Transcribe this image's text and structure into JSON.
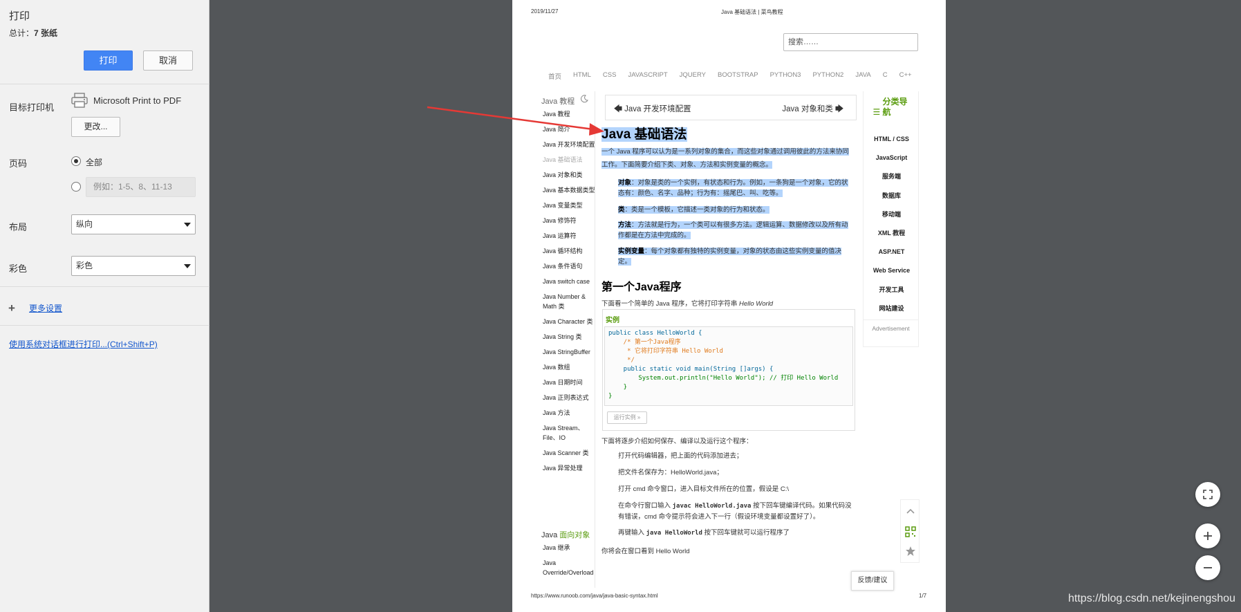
{
  "dialog": {
    "title": "打印",
    "total_label": "总计：",
    "total_value": "7 张纸",
    "print_label": "打印",
    "cancel_label": "取消",
    "destination_label": "目标打印机",
    "printer_name": "Microsoft Print to PDF",
    "change_label": "更改...",
    "pages_label": "页码",
    "pages_all": "全部",
    "pages_placeholder": "例如：1-5、8、11-13",
    "layout_label": "布局",
    "layout_value": "纵向",
    "color_label": "彩色",
    "color_value": "彩色",
    "more_settings": "更多设置",
    "system_dialog": "使用系统对话框进行打印...(Ctrl+Shift+P)",
    "accent_color": "#4285f4"
  },
  "preview": {
    "date": "2019/11/27",
    "header_title": "Java 基础语法 | 菜鸟教程",
    "search_placeholder": "搜索……",
    "nav": [
      "首页",
      "HTML",
      "CSS",
      "JAVASCRIPT",
      "JQUERY",
      "BOOTSTRAP",
      "PYTHON3",
      "PYTHON2",
      "JAVA",
      "C",
      "C++"
    ],
    "left": {
      "heading": "Java 教程",
      "items": [
        "Java 教程",
        "Java 简介",
        "Java 开发环境配置",
        "Java 基础语法",
        "Java 对象和类",
        "Java 基本数据类型",
        "Java 变量类型",
        "Java 修饰符",
        "Java 运算符",
        "Java 循环结构",
        "Java 条件语句",
        "Java switch case",
        "Java Number & Math 类",
        "Java Character 类",
        "Java String 类",
        "Java StringBuffer",
        "Java 数组",
        "Java 日期时间",
        "Java 正则表达式",
        "Java 方法",
        "Java Stream、File、IO",
        "Java Scanner 类",
        "Java 异常处理"
      ],
      "group_prefix": "Java ",
      "group_suffix": "面向对象",
      "sub_items": [
        "Java 继承",
        "Java Override/Overload"
      ]
    },
    "main": {
      "prev": "Java 开发环境配置",
      "next": "Java 对象和类",
      "title": "Java 基础语法",
      "intro": "一个 Java 程序可以认为是一系列对象的集合，而这些对象通过调用彼此的方法来协同工作。下面简要介绍下类、对象、方法和实例变量的概念。",
      "defs": [
        {
          "term": "对象",
          "text": "：对象是类的一个实例，有状态和行为。例如，一条狗是一个对象，它的状态有：颜色、名字、品种；行为有：摇尾巴、叫、吃等。"
        },
        {
          "term": "类",
          "text": "：类是一个模板，它描述一类对象的行为和状态。"
        },
        {
          "term": "方法",
          "text": "：方法就是行为，一个类可以有很多方法。逻辑运算、数据修改以及所有动作都是在方法中完成的。"
        },
        {
          "term": "实例变量",
          "text": "：每个对象都有独特的实例变量，对象的状态由这些实例变量的值决定。"
        }
      ],
      "h2": "第一个Java程序",
      "h2_intro": "下面看一个简单的 Java 程序，它将打印字符串 ",
      "h2_intro_em": "Hello World",
      "example_title": "实例",
      "code_lines": [
        "public class HelloWorld {",
        "    /* 第一个Java程序",
        "     * 它将打印字符串 Hello World",
        "     */",
        "    public static void main(String []args) {",
        "        System.out.println(\"Hello World\"); // 打印 Hello World",
        "    }",
        "}"
      ],
      "run_label": "运行实例 »",
      "steps_intro": "下面将逐步介绍如何保存、编译以及运行这个程序：",
      "step1": "打开代码编辑器，把上面的代码添加进去；",
      "step2": "把文件名保存为：HelloWorld.java；",
      "step3": "打开 cmd 命令窗口，进入目标文件所在的位置，假设是 C:\\",
      "step4_a": "在命令行窗口输入 ",
      "step4_code": "javac HelloWorld.java",
      "step4_b": " 按下回车键编译代码。如果代码没有错误，cmd 命令提示符会进入下一行（假设环境变量都设置好了）。",
      "step5_a": "再键输入 ",
      "step5_code": "java HelloWorld",
      "step5_b": " 按下回车键就可以运行程序了",
      "outro": "你将会在窗口看到 Hello World"
    },
    "right": {
      "heading_icon": "list-icon",
      "heading": "分类导航",
      "items": [
        "HTML / CSS",
        "JavaScript",
        "服务端",
        "数据库",
        "移动端",
        "XML 教程",
        "ASP.NET",
        "Web Service",
        "开发工具",
        "网站建设"
      ]
    },
    "ad": "Advertisement",
    "feedback": "反馈/建议",
    "url": "https://www.runoob.com/java/java-basic-syntax.html",
    "page_num": "1/7"
  },
  "watermark": "https://blog.csdn.net/kejinengshou"
}
